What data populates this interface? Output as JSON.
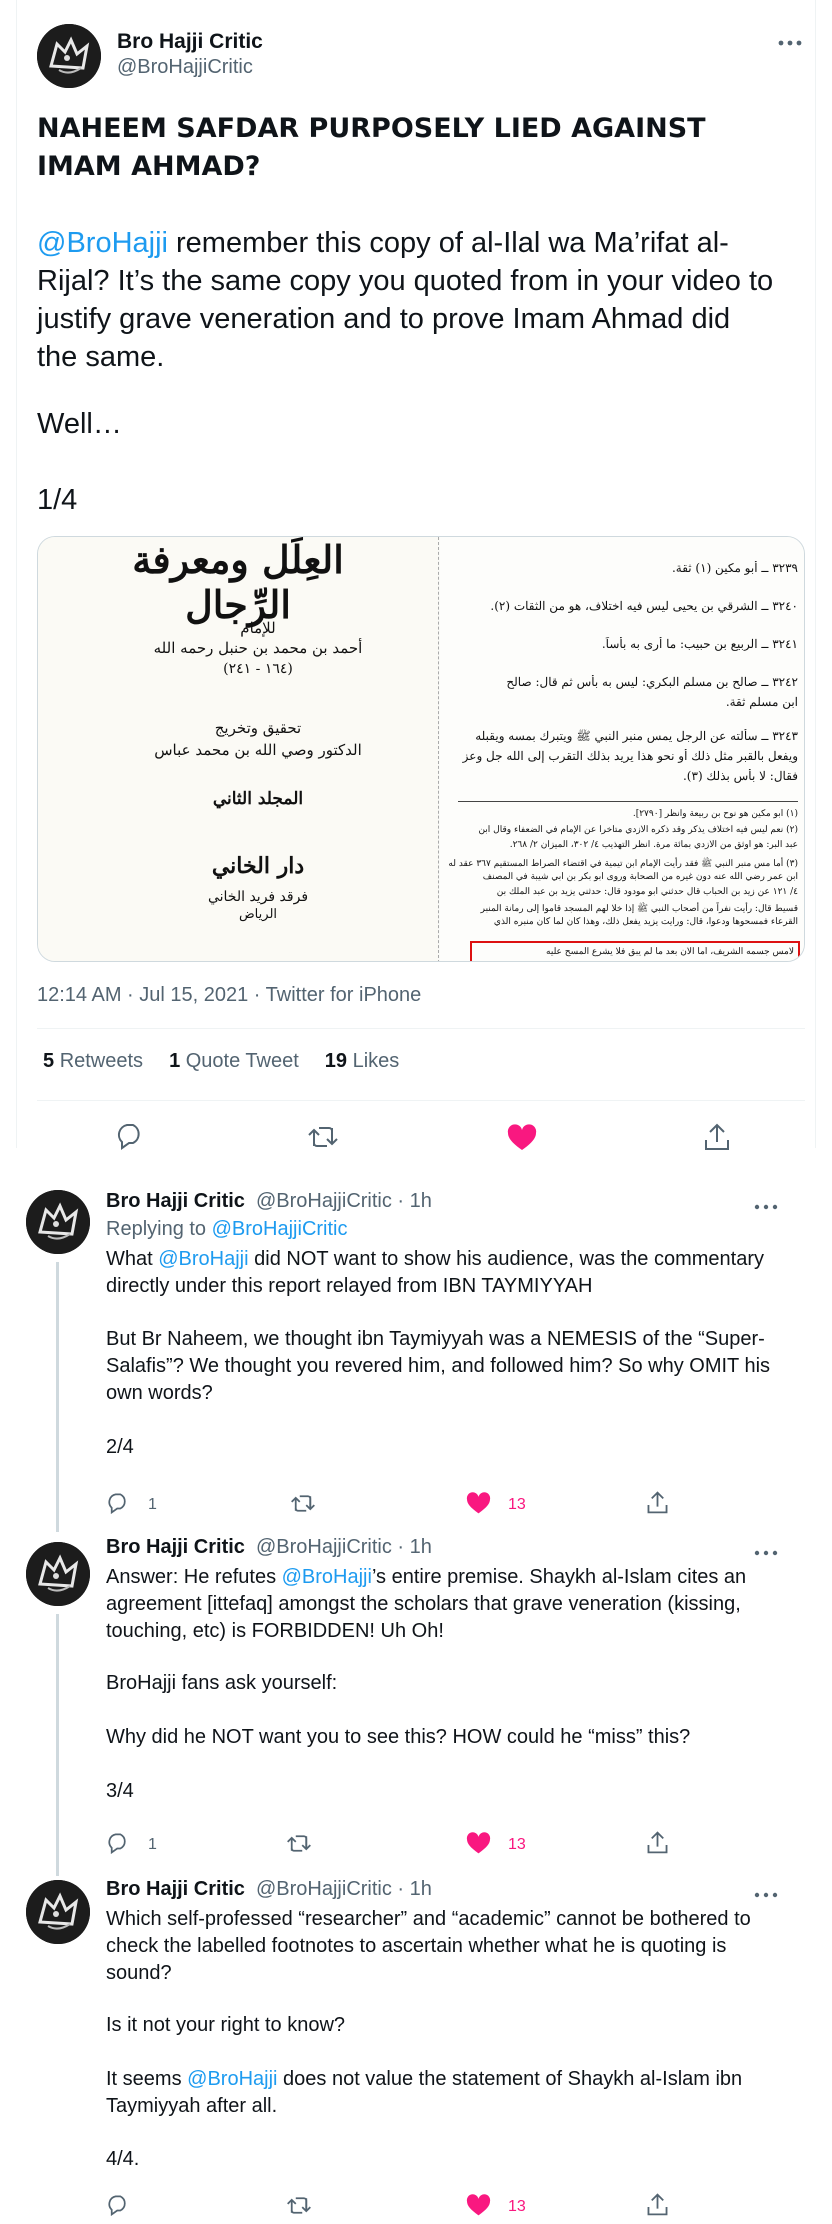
{
  "main_tweet": {
    "author_name": "Bro Hajji Critic",
    "author_handle": "@BroHajjiCritic",
    "heading": "NAHEEM SAFDAR PURPOSELY LIED AGAINST IMAM AHMAD?",
    "mention": "@BroHajji",
    "body_after_mention": " remember this copy of al-Ilal wa Ma’rifat al-Rijal? It’s the same copy you quoted from in your video to justify grave veneration and to prove Imam Ahmad did the same.",
    "line_well": "Well…",
    "line_count": "1/4",
    "timestamp": "12:14 AM · Jul 15, 2021 · Twitter for iPhone",
    "retweets_count": "5",
    "retweets_label": "Retweets",
    "quote_count": "1",
    "quote_label": "Quote Tweet",
    "likes_count": "19",
    "likes_label": "Likes",
    "media": {
      "left_title": "العِلَل ومعرفة الرِّجال",
      "left_line1": "للإمام",
      "left_line2": "أحمد بن محمد بن حنبل رحمه الله",
      "left_line3": "(١٦٤ - ٢٤١)",
      "left_line4": "تحقيق وتخريج",
      "left_line5": "الدكتور وصي الله بن محمد عباس",
      "left_line6": "المجلد الثاني",
      "left_line7": "دار الخاني",
      "left_line8": "فرقد فريد الخاني",
      "left_line9": "الرياض",
      "right_lines": [
        "٣٢٣٩ ــ أبو مكين (١) ثقة.",
        "٣٢٤٠ ــ الشرقي بن يحيى ليس فيه اختلاف، هو من الثقات (٢).",
        "٣٢٤١ ــ الربيع بن حبيب: ما أرى به بأساً.",
        "٣٢٤٢ ــ صالح بن مسلم البكري: ليس به بأس ثم قال: صالح",
        "ابن مسلم ثقة.",
        "٣٢٤٣ ــ سألته عن الرجل يمس منبر النبي ﷺ ويتبرك بمسه ويقبله",
        "ويفعل بالقبر مثل ذلك أو نحو هذا يريد بذلك التقرب إلى الله جل وعز",
        "فقال: لا بأس بذلك (٣)."
      ],
      "footnote_lines": [
        "(١) أبو مكين هو نوح بن ربيعة وانظر [٢٧٩٠].",
        "(٢) نعم ليس فيه اختلاف يذكر وقد ذكره الأزدي متأخراً عن الإمام في الضعفاء وقال ابن",
        "عبد البر: هو أوثق من الأزدي بمائة مرة. انظر التهذيب ٤/ ٣٠٢، الميزان ٢/ ٢٦٨.",
        "(٣) أما مس منبر النبي ﷺ فقد رأيت الإمام ابن تيمية في اقتضاء الصراط المستقيم ٣٦٧ عقد له",
        "ابن عمر رضي الله عنه دون غيره من الصحابة وروى أبو بكر بن أبي شيبة في المصنف",
        "٤/ ١٢١ عن زيد بن الحباب قال حدثني أبو مودود قال: حدثني يزيد بن عبد الملك بن",
        "قسيط قال: رأيت نفراً من أصحاب النبي ﷺ إذا خلا لهم المسجد قاموا إلى رمانة المنبر",
        "القرعاء فمسحوها ودعوا، قال: ورأيت يزيد يفعل ذلك، وهذا كان لما كان منبره الذي",
        "لامس جسمه الشريف، أما الآن بعد ما لم يبق فلا يشرع المسح عليه"
      ]
    }
  },
  "replies": [
    {
      "author_name": "Bro Hajji Critic",
      "author_meta": "@BroHajjiCritic · 1h",
      "replying_prefix": "Replying to ",
      "replying_handle": "@BroHajjiCritic",
      "p1_before": "What ",
      "p1_mention": "@BroHajji",
      "p1_after": " did NOT want to show his audience, was the commentary directly under this report relayed from IBN TAYMIYYAH",
      "p2": "But Br Naheem, we thought ibn Taymiyyah was a NEMESIS of the “Super-Salafis”? We thought you revered him, and followed him? So why OMIT his own words?",
      "p3": "2/4",
      "reply_count": "1",
      "like_count": "13"
    },
    {
      "author_name": "Bro Hajji Critic",
      "author_meta": "@BroHajjiCritic · 1h",
      "p1_before": "Answer: He refutes ",
      "p1_mention": "@BroHajji",
      "p1_after": "’s entire premise. Shaykh al-Islam cites an agreement [ittefaq] amongst the scholars that grave veneration (kissing, touching, etc) is FORBIDDEN! Uh Oh!",
      "p2": "BroHajji fans ask yourself:",
      "p3": "Why did he NOT want you to see this? HOW could he “miss” this?",
      "p4": "3/4",
      "reply_count": "1",
      "like_count": "13"
    },
    {
      "author_name": "Bro Hajji Critic",
      "author_meta": "@BroHajjiCritic · 1h",
      "p1": "Which self-professed “researcher” and “academic” cannot be bothered to check the labelled footnotes to ascertain whether what he is quoting is sound?",
      "p2": "Is it not your right to know?",
      "p3_before": "It seems ",
      "p3_mention": "@BroHajji",
      "p3_after": " does not value the statement of Shaykh al-Islam ibn Taymiyyah after all.",
      "p4": "4/4.",
      "like_count": "13"
    }
  ],
  "colors": {
    "text": "#0f1419",
    "secondary": "#536471",
    "link": "#1d9bf0",
    "like": "#f91880",
    "border": "#eff3f4"
  },
  "icons": [
    "more-icon",
    "reply-icon",
    "retweet-icon",
    "like-icon",
    "share-icon",
    "avatar-logo"
  ]
}
